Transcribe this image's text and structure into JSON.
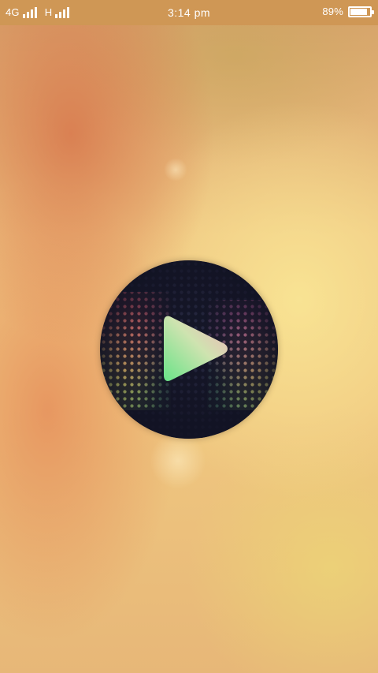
{
  "status_bar": {
    "network_1": "4G",
    "network_2": "H",
    "time": "3:14 pm",
    "battery_percent": "89%",
    "battery_level": 0.89
  },
  "center_logo": {
    "icon": "play-icon"
  },
  "colors": {
    "status_bar_bg": "#cf9755",
    "logo_bg": "#16172a",
    "play_gradient_start": "#7be38f",
    "play_gradient_end": "#e9c2b5"
  }
}
